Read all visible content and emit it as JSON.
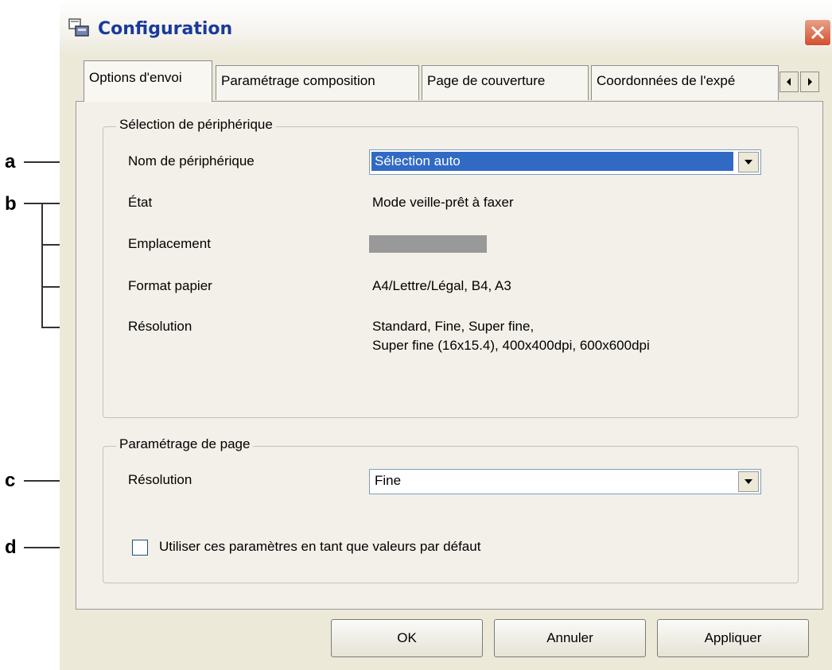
{
  "window": {
    "title": "Configuration"
  },
  "tabs": [
    {
      "label": "Options d'envoi",
      "active": true
    },
    {
      "label": "Paramétrage composition",
      "active": false
    },
    {
      "label": "Page de couverture",
      "active": false
    },
    {
      "label": "Coordonnées de l'expé",
      "active": false
    }
  ],
  "device_group": {
    "legend": "Sélection de périphérique",
    "device_name_label": "Nom de périphérique",
    "device_name_value": "Sélection auto",
    "state_label": "État",
    "state_value": "Mode veille-prêt à faxer",
    "location_label": "Emplacement",
    "paper_label": "Format papier",
    "paper_value": "A4/Lettre/Légal, B4, A3",
    "resolution_label": "Résolution",
    "resolution_value_1": "Standard, Fine, Super fine,",
    "resolution_value_2": "Super fine (16x15.4), 400x400dpi, 600x600dpi"
  },
  "page_group": {
    "legend": "Paramétrage de page",
    "resolution_label": "Résolution",
    "resolution_value": "Fine",
    "default_checkbox_label": "Utiliser ces paramètres en tant que valeurs par défaut",
    "default_checked": false
  },
  "buttons": {
    "ok": "OK",
    "cancel": "Annuler",
    "apply": "Appliquer"
  },
  "callouts": {
    "a": "a",
    "b": "b",
    "c": "c",
    "d": "d"
  },
  "colors": {
    "title_text": "#1a3a9a",
    "selection": "#316ac5",
    "close_button": "#d2502e",
    "dialog_bg": "#ece9d8"
  }
}
